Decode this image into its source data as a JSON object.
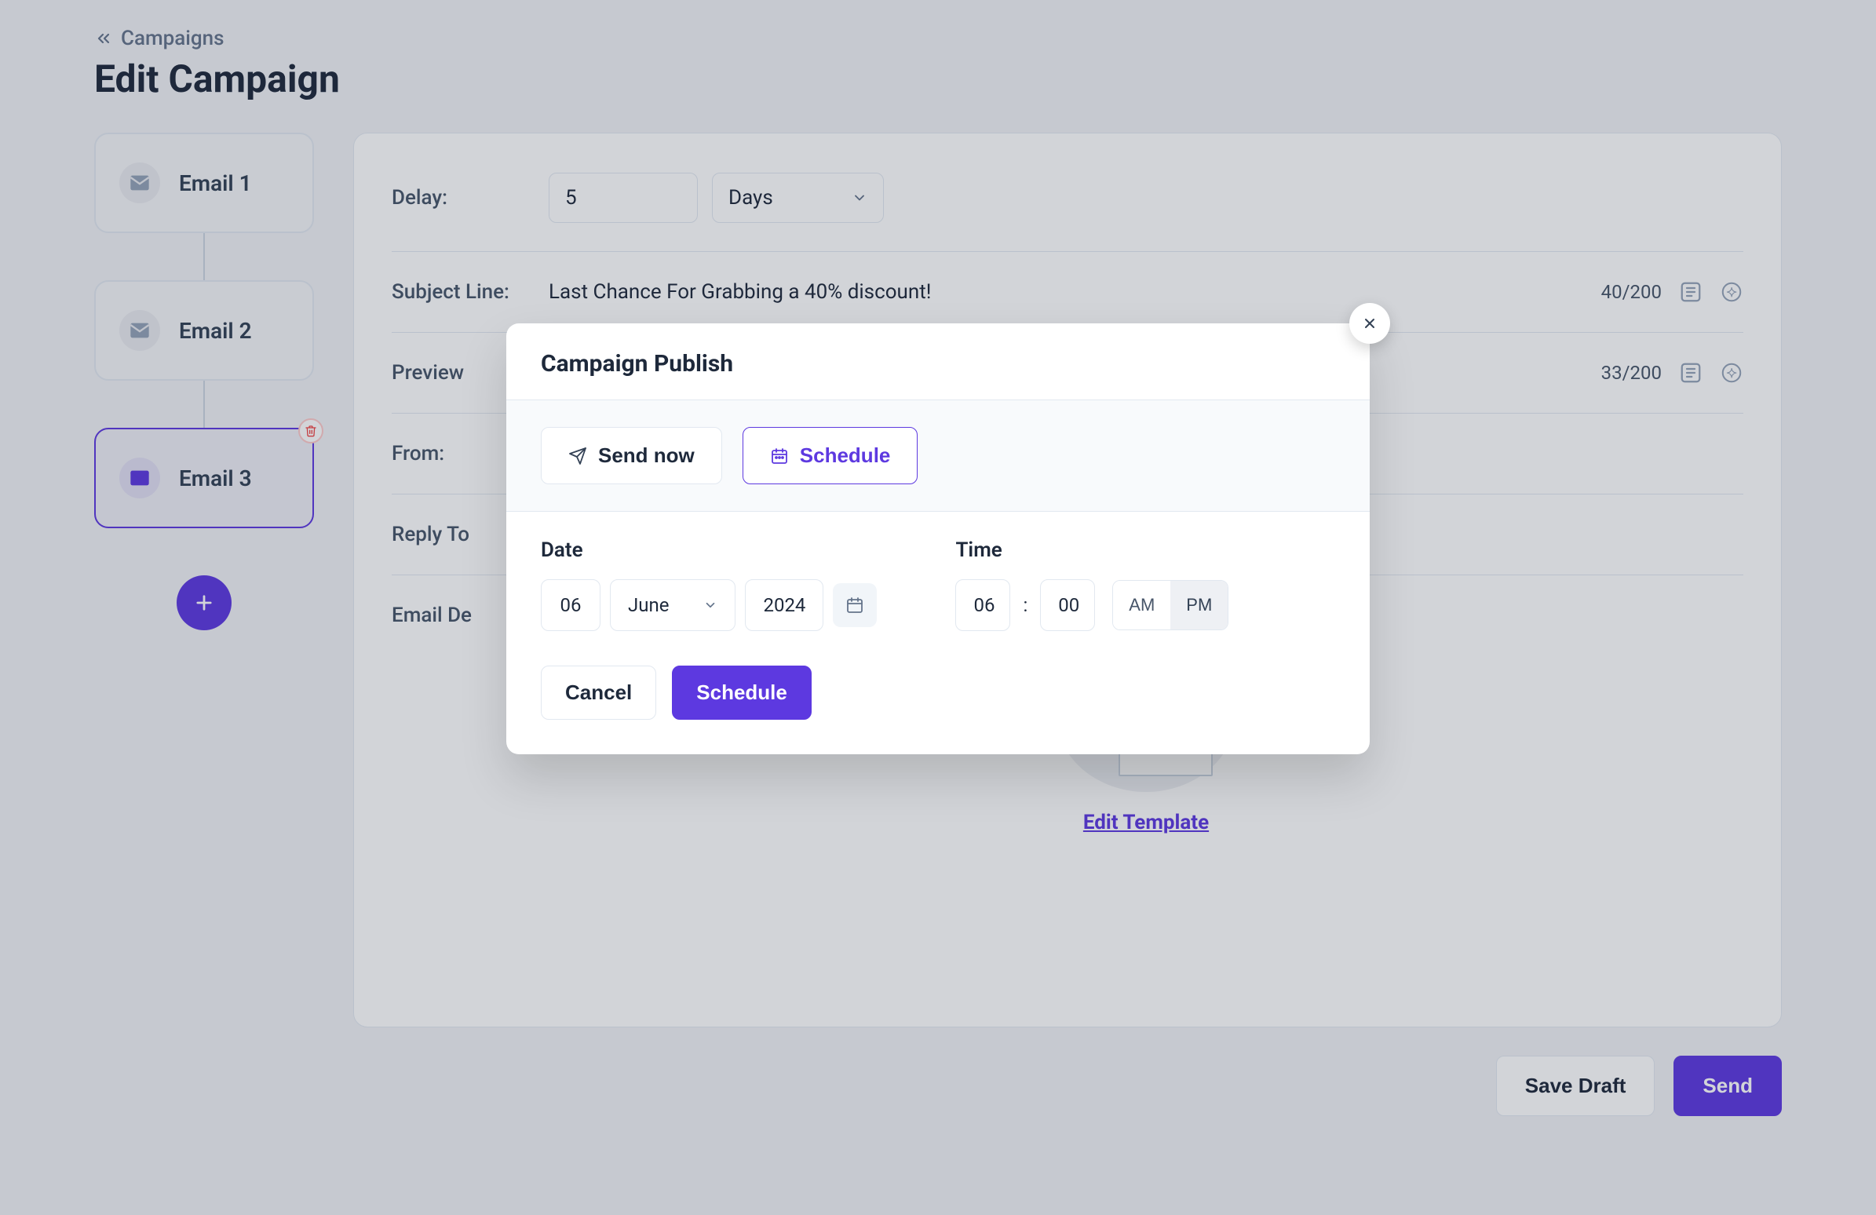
{
  "breadcrumb": {
    "label": "Campaigns"
  },
  "page_title": "Edit Campaign",
  "steps": [
    {
      "label": "Email 1"
    },
    {
      "label": "Email 2"
    },
    {
      "label": "Email 3"
    }
  ],
  "editor": {
    "delay": {
      "label": "Delay:",
      "value": "5",
      "unit": "Days"
    },
    "subject": {
      "label": "Subject Line:",
      "value": "Last Chance For Grabbing a 40% discount!",
      "counter": "40/200"
    },
    "preview": {
      "label": "Preview",
      "counter": "33/200"
    },
    "from": {
      "label": "From:"
    },
    "reply_to": {
      "label": "Reply To"
    },
    "email_design": {
      "label": "Email De"
    },
    "edit_template": "Edit Template"
  },
  "footer": {
    "save_draft": "Save Draft",
    "send": "Send"
  },
  "modal": {
    "title": "Campaign Publish",
    "tabs": {
      "send_now": "Send now",
      "schedule": "Schedule"
    },
    "date": {
      "label": "Date",
      "day": "06",
      "month": "June",
      "year": "2024"
    },
    "time": {
      "label": "Time",
      "hour": "06",
      "minute": "00",
      "am": "AM",
      "pm": "PM"
    },
    "actions": {
      "cancel": "Cancel",
      "schedule": "Schedule"
    }
  }
}
